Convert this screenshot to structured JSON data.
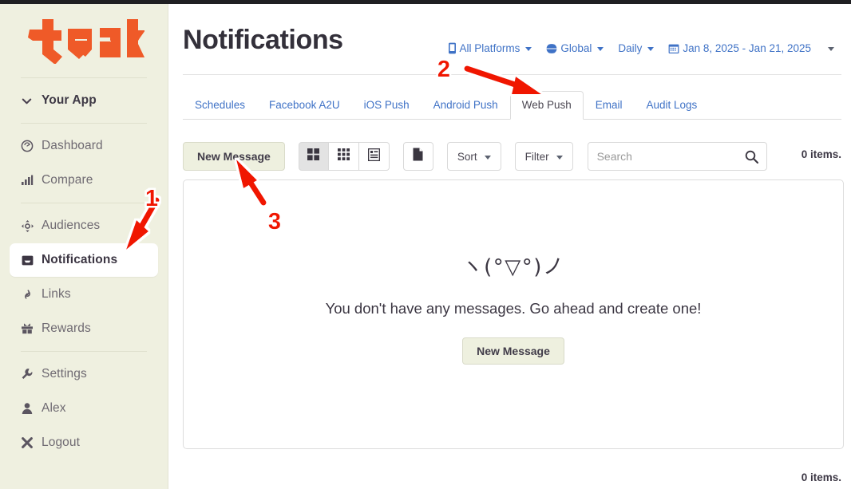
{
  "brand": {
    "logo_text": "teak",
    "logo_color": "#ef5a28"
  },
  "sidebar": {
    "app": {
      "label": "Your App",
      "icon": "chevron-down-icon"
    },
    "groups": [
      {
        "items": [
          {
            "label": "Dashboard",
            "icon": "gauge-icon",
            "active": false
          },
          {
            "label": "Compare",
            "icon": "bar-chart-icon",
            "active": false
          }
        ]
      },
      {
        "items": [
          {
            "label": "Audiences",
            "icon": "move-crosshair-icon",
            "active": false
          },
          {
            "label": "Notifications",
            "icon": "inbox-icon",
            "active": true
          },
          {
            "label": "Links",
            "icon": "chain-link-icon",
            "active": false
          },
          {
            "label": "Rewards",
            "icon": "gift-icon",
            "active": false
          }
        ]
      },
      {
        "items": [
          {
            "label": "Settings",
            "icon": "wrench-icon",
            "active": false
          },
          {
            "label": "Alex",
            "icon": "user-icon",
            "active": false
          },
          {
            "label": "Logout",
            "icon": "x-mark-icon",
            "active": false
          }
        ]
      }
    ]
  },
  "header": {
    "title": "Notifications",
    "filters": [
      {
        "label": "All Platforms",
        "icon": "mobile-phone-icon",
        "caret": true
      },
      {
        "label": "Global",
        "icon": "globe-icon",
        "caret": true
      },
      {
        "label": "Daily",
        "icon": "",
        "caret": true
      },
      {
        "label": "Jan 8, 2025 - Jan 21, 2025",
        "icon": "calendar-icon",
        "caret": false
      }
    ],
    "extra_caret": true
  },
  "tabs": [
    {
      "label": "Schedules",
      "active": false
    },
    {
      "label": "Facebook A2U",
      "active": false
    },
    {
      "label": "iOS Push",
      "active": false
    },
    {
      "label": "Android Push",
      "active": false
    },
    {
      "label": "Web Push",
      "active": true
    },
    {
      "label": "Email",
      "active": false
    },
    {
      "label": "Audit Logs",
      "active": false
    }
  ],
  "toolbar": {
    "new_message_label": "New Message",
    "view_buttons": [
      {
        "icon": "grid-2x2-icon",
        "selected": true
      },
      {
        "icon": "grid-3x3-icon",
        "selected": false
      },
      {
        "icon": "list-detail-icon",
        "selected": false
      }
    ],
    "page_button": {
      "icon": "document-page-icon"
    },
    "sort_label": "Sort",
    "filter_label": "Filter",
    "search_placeholder": "Search",
    "search_value": "",
    "search_icon": "magnifier-icon"
  },
  "status": {
    "items_top": "0 items.",
    "items_bottom": "0 items."
  },
  "empty_state": {
    "kaomoji": "ヽ(°▽°)ノ",
    "message": "You don't have any messages. Go ahead and create one!",
    "button_label": "New Message"
  },
  "annotations": [
    {
      "number": "1",
      "color": "#f01800",
      "target": "sidebar-item-notifications"
    },
    {
      "number": "2",
      "color": "#f01800",
      "target": "tab-web-push"
    },
    {
      "number": "3",
      "color": "#f01800",
      "target": "new-message-button"
    }
  ]
}
